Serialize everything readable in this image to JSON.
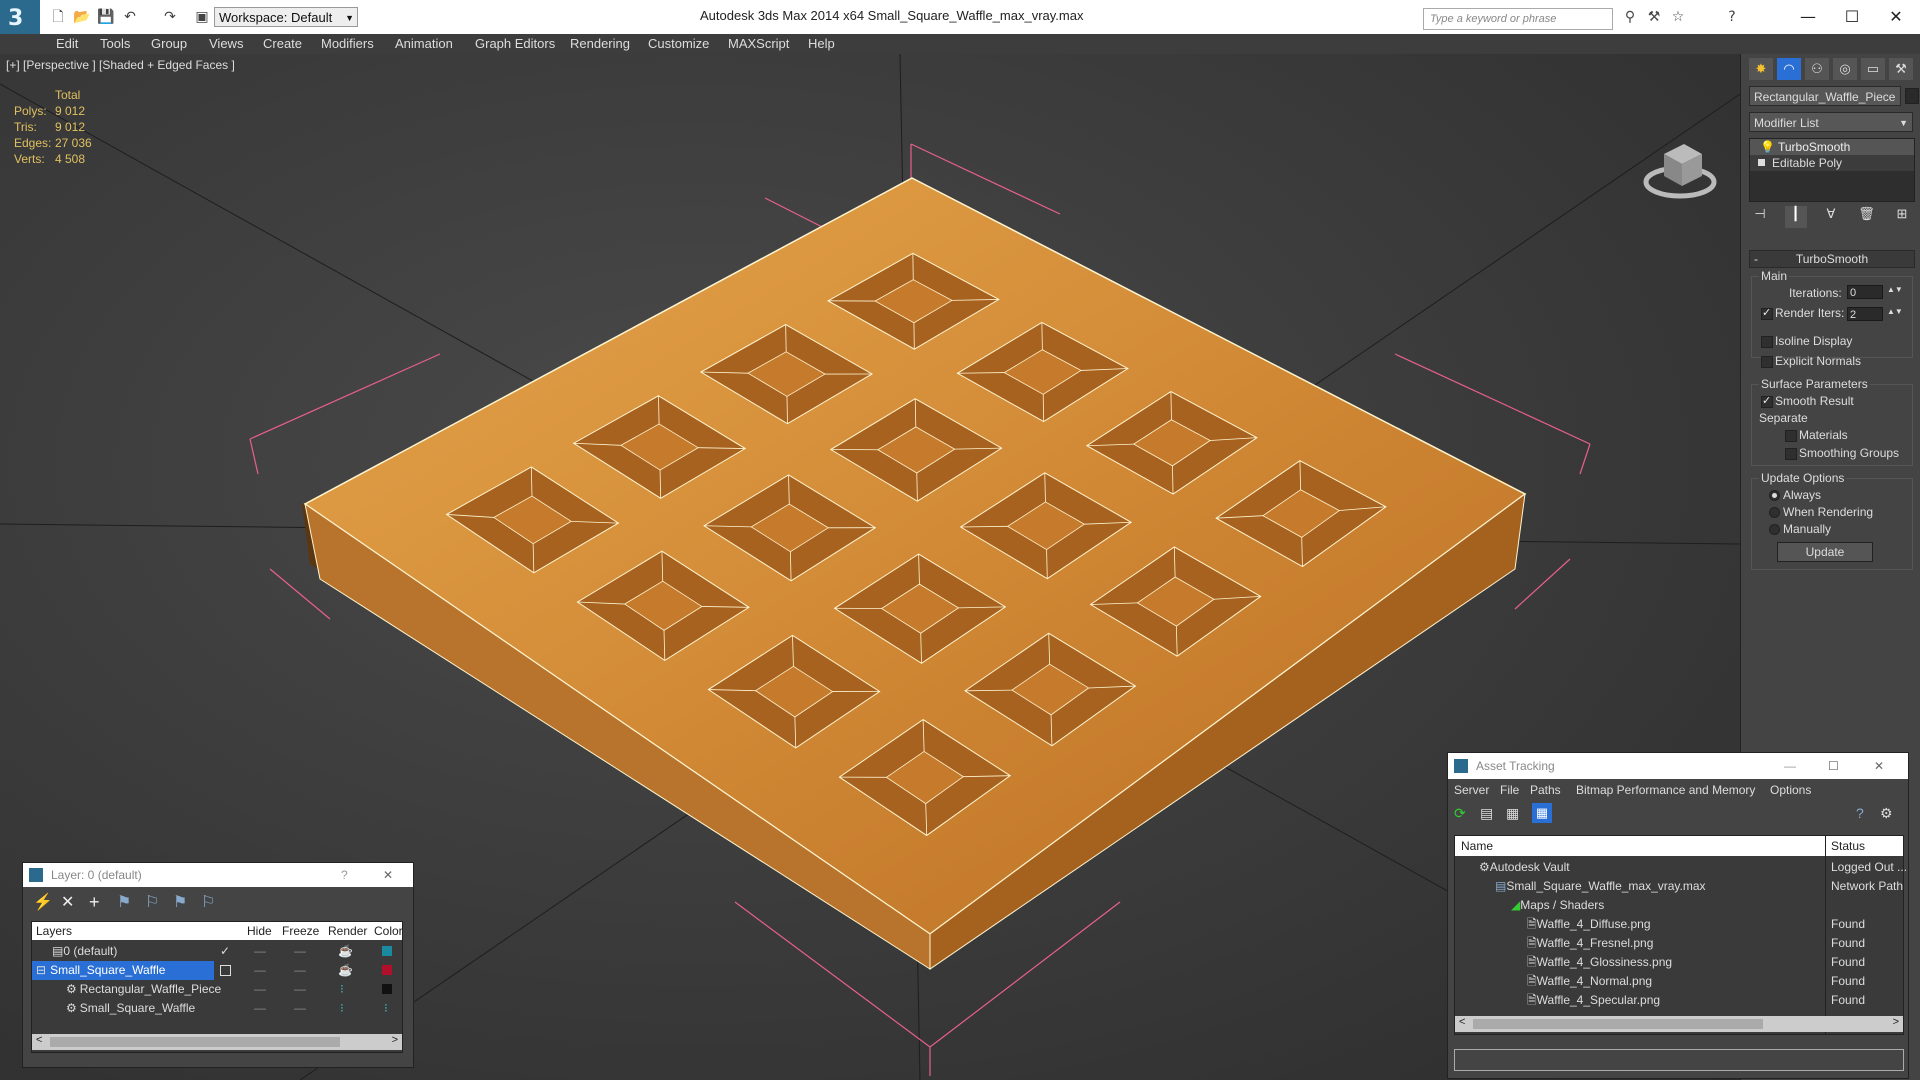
{
  "title_bar": {
    "app_title": "Autodesk 3ds Max  2014 x64      Small_Square_Waffle_max_vray.max",
    "workspace": "Workspace: Default",
    "search_placeholder": "Type a keyword or phrase",
    "minimize": "—",
    "maximize": "☐",
    "close": "✕"
  },
  "menu": [
    "Edit",
    "Tools",
    "Group",
    "Views",
    "Create",
    "Modifiers",
    "Animation",
    "Graph Editors",
    "Rendering",
    "Customize",
    "MAXScript",
    "Help"
  ],
  "viewport": {
    "label": "[+] [Perspective ] [Shaded + Edged Faces ]",
    "stats": {
      "header": "Total",
      "rows": [
        {
          "label": "Polys:",
          "value": "9 012"
        },
        {
          "label": "Tris:",
          "value": "9 012"
        },
        {
          "label": "Edges:",
          "value": "27 036"
        },
        {
          "label": "Verts:",
          "value": "4 508"
        }
      ]
    }
  },
  "command_panel": {
    "object_name": "Rectangular_Waffle_Piece",
    "modifier_list": "Modifier List",
    "stack": [
      "TurboSmooth",
      "Editable Poly"
    ],
    "rollout_title": "TurboSmooth",
    "main_label": "Main",
    "iterations_label": "Iterations:",
    "iterations_value": "0",
    "render_iters_label": "Render Iters:",
    "render_iters_value": "2",
    "isoline_label": "Isoline Display",
    "explicit_normals_label": "Explicit Normals",
    "surface_params_label": "Surface Parameters",
    "smooth_result_label": "Smooth Result",
    "separate_label": "Separate",
    "materials_label": "Materials",
    "smoothing_groups_label": "Smoothing Groups",
    "update_options_label": "Update Options",
    "always_label": "Always",
    "when_rendering_label": "When Rendering",
    "manually_label": "Manually",
    "update_button": "Update"
  },
  "layer_window": {
    "title": "Layer: 0 (default)",
    "help": "?",
    "close": "✕",
    "columns": [
      "Layers",
      "Hide",
      "Freeze",
      "Render",
      "Color"
    ],
    "rows": [
      {
        "name": "0 (default)",
        "color": "#1a8aa0"
      },
      {
        "name": "Small_Square_Waffle",
        "color": "#b0102a"
      },
      {
        "name": "Rectangular_Waffle_Piece",
        "color": "#111111"
      },
      {
        "name": "Small_Square_Waffle",
        "color": "#111111"
      }
    ]
  },
  "asset_window": {
    "title": "Asset Tracking",
    "menu": [
      "Server",
      "File",
      "Paths",
      "Bitmap Performance and Memory",
      "Options"
    ],
    "columns": [
      "Name",
      "Status"
    ],
    "rows": [
      {
        "name": "Autodesk Vault",
        "status": "Logged Out ..."
      },
      {
        "name": "Small_Square_Waffle_max_vray.max",
        "status": "Network Path"
      },
      {
        "name": "Maps / Shaders",
        "status": ""
      },
      {
        "name": "Waffle_4_Diffuse.png",
        "status": "Found"
      },
      {
        "name": "Waffle_4_Fresnel.png",
        "status": "Found"
      },
      {
        "name": "Waffle_4_Glossiness.png",
        "status": "Found"
      },
      {
        "name": "Waffle_4_Normal.png",
        "status": "Found"
      },
      {
        "name": "Waffle_4_Specular.png",
        "status": "Found"
      }
    ]
  },
  "colors": {
    "accent": "#2b6a8c",
    "selection": "#2a6fd6",
    "stats": "#e0c060",
    "waffle": "#d9923a"
  }
}
